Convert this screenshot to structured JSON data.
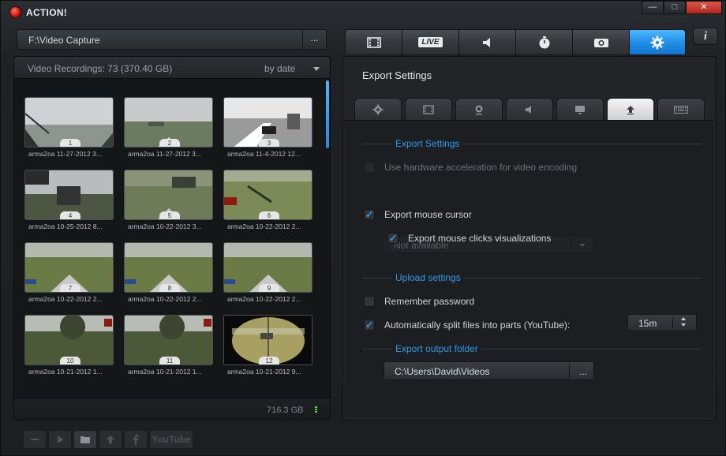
{
  "app": {
    "title": "ACTION!"
  },
  "window_controls": {
    "minimize": "—",
    "maximize": "□",
    "close": "✕"
  },
  "path_bar": {
    "path": "F:\\Video Capture",
    "browse_label": "..."
  },
  "recordings": {
    "header": "Video Recordings: 73 (370.40 GB)",
    "sort_label": "by date",
    "disk_free": "716.3 GB",
    "items": [
      {
        "num": "1",
        "label": "arma2oa 11-27-2012 3..."
      },
      {
        "num": "2",
        "label": "arma2oa 11-27-2012 3..."
      },
      {
        "num": "3",
        "label": "arma2oa 11-4-2012 12..."
      },
      {
        "num": "4",
        "label": "arma2oa 10-25-2012 8..."
      },
      {
        "num": "5",
        "label": "arma2oa 10-22-2012 3..."
      },
      {
        "num": "6",
        "label": "arma2oa 10-22-2012 2..."
      },
      {
        "num": "7",
        "label": "arma2oa 10-22-2012 2..."
      },
      {
        "num": "8",
        "label": "arma2oa 10-22-2012 2..."
      },
      {
        "num": "9",
        "label": "arma2oa 10-22-2012 2..."
      },
      {
        "num": "10",
        "label": "arma2oa 10-21-2012 1..."
      },
      {
        "num": "11",
        "label": "arma2oa 10-21-2012 1..."
      },
      {
        "num": "12",
        "label": "arma2oa 10-21-2012 9..."
      }
    ]
  },
  "bottom_toolbar": {
    "youtube_label": "YouTube"
  },
  "main_tabs": [
    {
      "icon": "film-icon"
    },
    {
      "label": "LIVE",
      "icon": "live-icon"
    },
    {
      "icon": "speaker-icon"
    },
    {
      "icon": "stopwatch-icon"
    },
    {
      "icon": "camera-icon"
    },
    {
      "icon": "gear-icon",
      "active": true
    }
  ],
  "info_button": {
    "label": "i"
  },
  "export_settings": {
    "title": "Export Settings",
    "sub_tabs": [
      {
        "icon": "gear-icon"
      },
      {
        "icon": "film-icon"
      },
      {
        "icon": "webcam-icon"
      },
      {
        "icon": "speaker-icon"
      },
      {
        "icon": "monitor-icon"
      },
      {
        "icon": "upload-icon",
        "active": true
      },
      {
        "icon": "keyboard-icon"
      }
    ],
    "section_export": "Export Settings",
    "hw_accel_label": "Use hardware acceleration for video encoding",
    "hw_accel_checked": false,
    "hw_accel_select_value": "Not available",
    "mouse_cursor_label": "Export mouse cursor",
    "mouse_cursor_checked": true,
    "mouse_clicks_label": "Export mouse clicks visualizations",
    "mouse_clicks_checked": true,
    "section_upload": "Upload settings",
    "remember_password_label": "Remember password",
    "remember_password_checked": false,
    "split_files_label": "Automatically split files into parts (YouTube):",
    "split_files_checked": true,
    "split_value": "15m",
    "section_folder": "Export output folder",
    "output_folder": "C:\\Users\\David\\Videos",
    "folder_browse_label": "..."
  },
  "colors": {
    "accent": "#2f9aea",
    "active_tab": "#1e8ce6",
    "close_button": "#c63a2e"
  }
}
